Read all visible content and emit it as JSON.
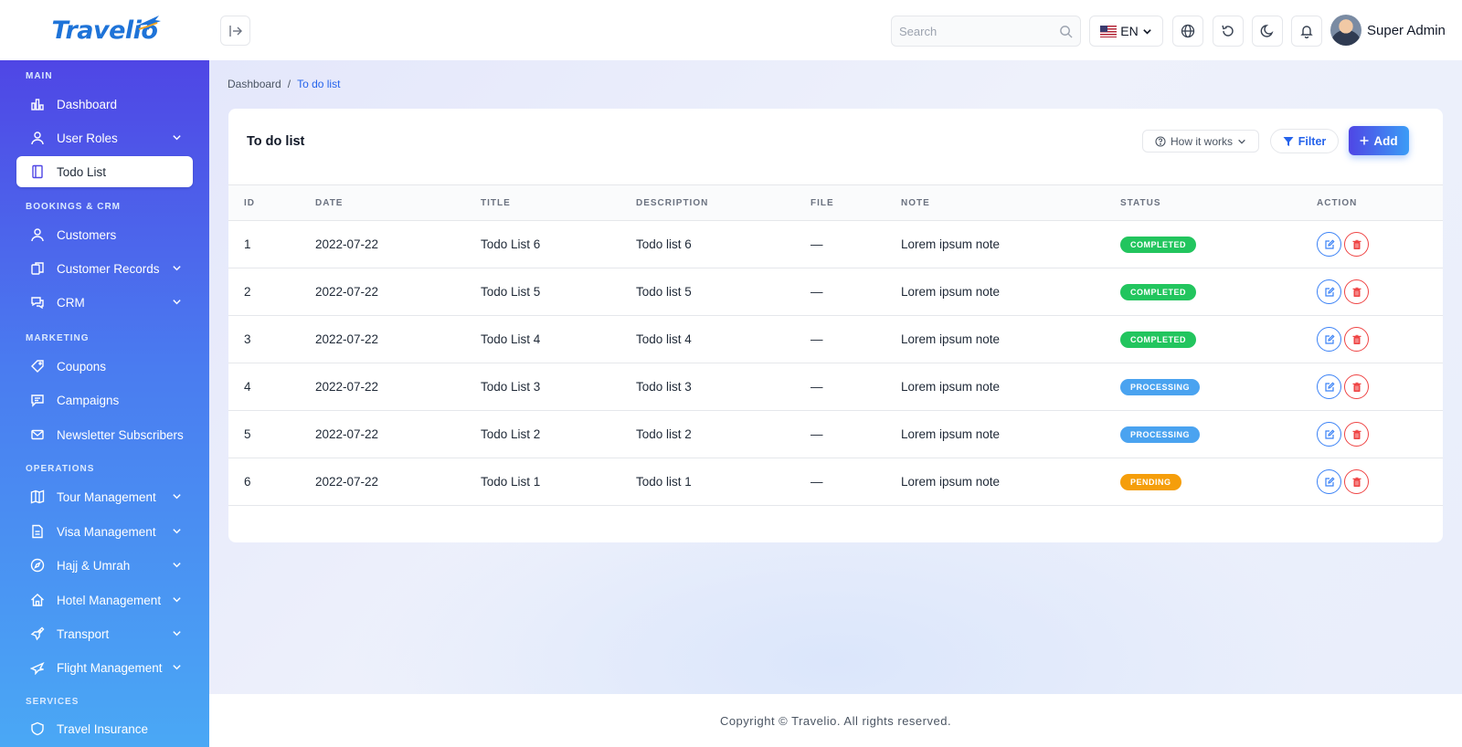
{
  "app": {
    "logo_text": "Travelio",
    "brand_color": "#1e73d8"
  },
  "topbar": {
    "search_placeholder": "Search",
    "language": "EN",
    "user_name": "Super Admin"
  },
  "sidebar": {
    "sections": {
      "main": "MAIN",
      "bookings": "BOOKINGS & CRM",
      "marketing": "MARKETING",
      "operations": "OPERATIONS",
      "services": "SERVICES"
    },
    "items": {
      "dashboard": "Dashboard",
      "user_roles": "User Roles",
      "todo_list": "Todo List",
      "customers": "Customers",
      "customer_records": "Customer Records",
      "crm": "CRM",
      "coupons": "Coupons",
      "campaigns": "Campaigns",
      "newsletter": "Newsletter Subscribers",
      "tour": "Tour Management",
      "visa": "Visa Management",
      "hajj": "Hajj & Umrah",
      "hotel": "Hotel Management",
      "transport": "Transport",
      "flight": "Flight Management",
      "insurance": "Travel Insurance"
    },
    "active": "todo_list"
  },
  "breadcrumb": {
    "home": "Dashboard",
    "separator": "/",
    "current": "To do list"
  },
  "card": {
    "title": "To do list",
    "how_label": "How it works",
    "filter_label": "Filter",
    "add_label": "Add"
  },
  "table": {
    "headers": [
      "ID",
      "DATE",
      "TITLE",
      "DESCRIPTION",
      "FILE",
      "NOTE",
      "STATUS",
      "ACTION"
    ],
    "rows": [
      {
        "id": "1",
        "date": "2022-07-22",
        "title": "Todo List 6",
        "description": "Todo list 6",
        "file": "—",
        "note": "Lorem ipsum note",
        "status": "COMPLETED",
        "status_kind": "completed"
      },
      {
        "id": "2",
        "date": "2022-07-22",
        "title": "Todo List 5",
        "description": "Todo list 5",
        "file": "—",
        "note": "Lorem ipsum note",
        "status": "COMPLETED",
        "status_kind": "completed"
      },
      {
        "id": "3",
        "date": "2022-07-22",
        "title": "Todo List 4",
        "description": "Todo list 4",
        "file": "—",
        "note": "Lorem ipsum note",
        "status": "COMPLETED",
        "status_kind": "completed"
      },
      {
        "id": "4",
        "date": "2022-07-22",
        "title": "Todo List 3",
        "description": "Todo list 3",
        "file": "—",
        "note": "Lorem ipsum note",
        "status": "PROCESSING",
        "status_kind": "processing"
      },
      {
        "id": "5",
        "date": "2022-07-22",
        "title": "Todo List 2",
        "description": "Todo list 2",
        "file": "—",
        "note": "Lorem ipsum note",
        "status": "PROCESSING",
        "status_kind": "processing"
      },
      {
        "id": "6",
        "date": "2022-07-22",
        "title": "Todo List 1",
        "description": "Todo list 1",
        "file": "—",
        "note": "Lorem ipsum note",
        "status": "PENDING",
        "status_kind": "pending"
      }
    ]
  },
  "status_colors": {
    "completed": "#22c55e",
    "processing": "#4aa3f0",
    "pending": "#f59e0b"
  },
  "footer": {
    "copyright": "Copyright © Travelio. All rights reserved."
  }
}
